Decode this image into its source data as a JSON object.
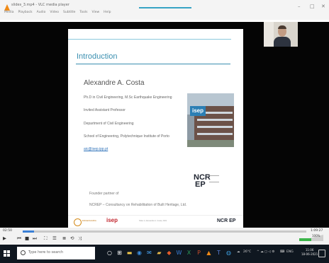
{
  "window": {
    "title": "slides_3.mp4 - VLC media player",
    "menu": [
      "Media",
      "Playback",
      "Audio",
      "Video",
      "Subtitle",
      "Tools",
      "View",
      "Help"
    ],
    "controls": {
      "minimize": "–",
      "maximize": "□",
      "close": "✕"
    }
  },
  "slide": {
    "title": "Introduction",
    "speaker_name": "Alexandre A. Costa",
    "lines": [
      "Ph.D in Civil Engineering, M.Sc Earthquake Engineering",
      "Invited Assistant Professor",
      "Department of Civil Engineering",
      "School of Engineering, Polytechnique Institute of Porto"
    ],
    "email": "aic@isep.ipp.pt",
    "isep_logo": "isep",
    "founder_lines": [
      "Founder partner of",
      "NCREP – Consultancy on Rehabilitation of Built Heritage, Ltd."
    ],
    "ncrep_logo": "NCR\nEP",
    "footer": {
      "left_seal_text": "ENGENHARIA",
      "isep_text": "isep",
      "center_text": "Slide 1 | Alexandre A. Costa, 2021",
      "right_logo": "NCR EP"
    }
  },
  "player": {
    "elapsed": "02:50",
    "total": "1:09:27",
    "progress_fraction": 0.04,
    "volume_percent": "100%",
    "volume_fraction": 0.5,
    "accent_color": "#3a7fd6",
    "volume_color": "#3cb54a",
    "buttons": [
      "play",
      "previous",
      "stop",
      "next",
      "fullscreen",
      "extended-settings",
      "playlist",
      "loop",
      "random"
    ]
  },
  "taskbar": {
    "search_placeholder": "Type here to search",
    "tray_weather": "26°C",
    "tray_lang": "ENG",
    "clock_time": "11:06",
    "clock_date": "18-06-2021"
  }
}
